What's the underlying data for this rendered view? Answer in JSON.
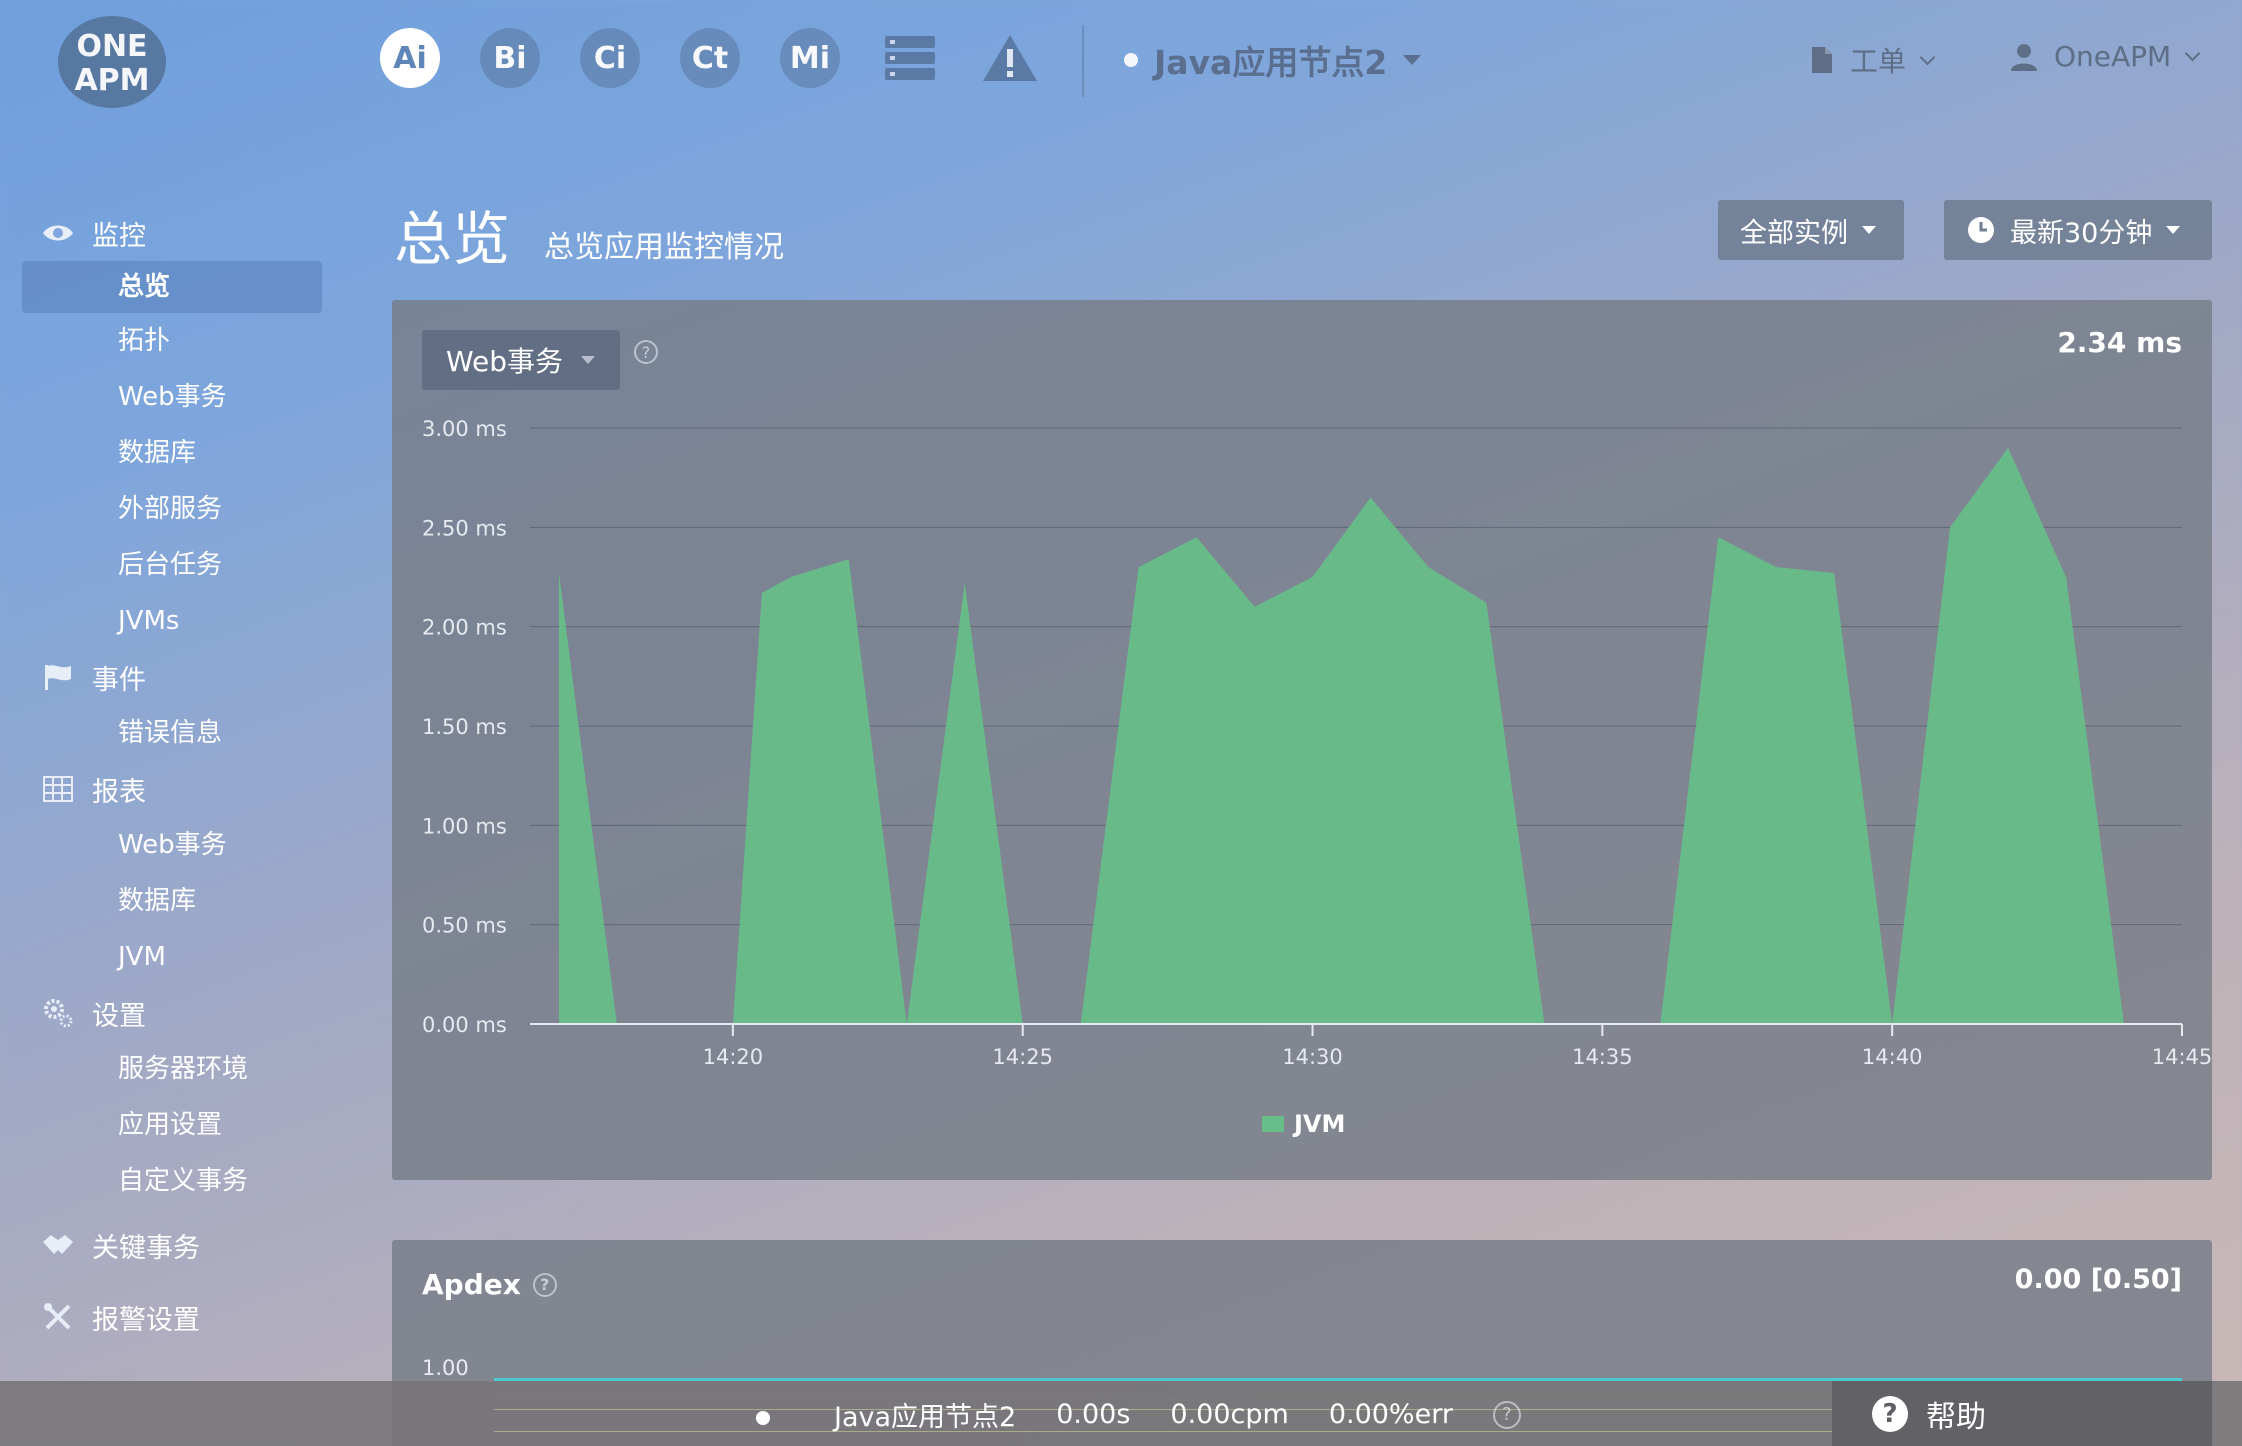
{
  "header": {
    "logo_text": "ONE APM",
    "products": [
      {
        "label": "Ai",
        "active": true
      },
      {
        "label": "Bi",
        "active": false
      },
      {
        "label": "Ci",
        "active": false
      },
      {
        "label": "Ct",
        "active": false
      },
      {
        "label": "Mi",
        "active": false
      }
    ],
    "app_name": "Java应用节点2",
    "ticket_label": "工单",
    "user_label": "OneAPM"
  },
  "sidebar": {
    "sections": [
      {
        "label": "监控",
        "icon": "eye-icon",
        "items": [
          "总览",
          "拓扑",
          "Web事务",
          "数据库",
          "外部服务",
          "后台任务",
          "JVMs"
        ]
      },
      {
        "label": "事件",
        "icon": "flag-icon",
        "items": [
          "错误信息"
        ]
      },
      {
        "label": "报表",
        "icon": "table-icon",
        "items": [
          "Web事务",
          "数据库",
          "JVM"
        ]
      },
      {
        "label": "设置",
        "icon": "gears-icon",
        "items": [
          "服务器环境",
          "应用设置",
          "自定义事务"
        ]
      },
      {
        "label": "关键事务",
        "icon": "handshake-icon",
        "items": []
      },
      {
        "label": "报警设置",
        "icon": "wrench-icon",
        "items": []
      }
    ],
    "active_item": "总览"
  },
  "page": {
    "title": "总览",
    "subtitle": "总览应用监控情况",
    "instance_filter": "全部实例",
    "time_filter": "最新30分钟"
  },
  "main_panel": {
    "metric_select": "Web事务",
    "current_value": "2.34 ms"
  },
  "chart_data": {
    "type": "area",
    "series": [
      {
        "name": "JVM",
        "color": "#66bf88",
        "points": [
          [
            "14:17",
            2.27
          ],
          [
            "14:18",
            0
          ],
          [
            "14:19",
            0
          ],
          [
            "14:20",
            0
          ],
          [
            "14:20:30",
            2.17
          ],
          [
            "14:21",
            2.25
          ],
          [
            "14:22",
            2.34
          ],
          [
            "14:23",
            0
          ],
          [
            "14:24",
            2.22
          ],
          [
            "14:25",
            0
          ],
          [
            "14:26",
            0
          ],
          [
            "14:27",
            2.3
          ],
          [
            "14:28",
            2.45
          ],
          [
            "14:29",
            2.1
          ],
          [
            "14:30",
            2.25
          ],
          [
            "14:31",
            2.65
          ],
          [
            "14:32",
            2.3
          ],
          [
            "14:33",
            2.12
          ],
          [
            "14:34",
            0
          ],
          [
            "14:35",
            0
          ],
          [
            "14:36",
            0
          ],
          [
            "14:37",
            2.45
          ],
          [
            "14:38",
            2.3
          ],
          [
            "14:39",
            2.27
          ],
          [
            "14:40",
            0
          ],
          [
            "14:41",
            2.5
          ],
          [
            "14:42",
            2.9
          ],
          [
            "14:43",
            2.25
          ],
          [
            "14:44",
            0
          ]
        ]
      }
    ],
    "xlabel": "",
    "ylabel": "",
    "y_ticks": [
      "0.00 ms",
      "0.50 ms",
      "1.00 ms",
      "1.50 ms",
      "2.00 ms",
      "2.50 ms",
      "3.00 ms"
    ],
    "x_ticks": [
      "14:20",
      "14:25",
      "14:30",
      "14:35",
      "14:40",
      "14:45"
    ],
    "ylim": [
      0,
      3
    ],
    "legend": [
      "JVM"
    ],
    "grid": true
  },
  "apdex": {
    "title": "Apdex",
    "value": "0.00 [0.50]",
    "y_tick": "1.00"
  },
  "statusbar": {
    "app_name": "Java应用节点2",
    "response": "0.00s",
    "throughput": "0.00cpm",
    "error_rate": "0.00%err",
    "help_label": "帮助"
  }
}
